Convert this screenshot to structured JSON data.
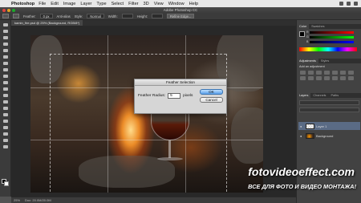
{
  "menubar": {
    "app_name": "Photoshop",
    "items": [
      "File",
      "Edit",
      "Image",
      "Layer",
      "Type",
      "Select",
      "Filter",
      "3D",
      "View",
      "Window",
      "Help"
    ]
  },
  "window": {
    "title": "Adobe Photoshop CC"
  },
  "options_bar": {
    "feather_label": "Feather:",
    "feather_value": "0 px",
    "antialias_label": "Anti-alias",
    "style_label": "Style:",
    "style_value": "Normal",
    "width_label": "Width:",
    "height_label": "Height:",
    "refine_edge": "Refine Edge..."
  },
  "document_tab": {
    "label": "kamin_fire.psd @ 25% (Background, RGB/8*)"
  },
  "status_bar": {
    "zoom": "25%",
    "doc_info": "Doc: 20.0M/20.0M"
  },
  "dialog": {
    "title": "Feather Selection",
    "field_label": "Feather Radius:",
    "field_value": "5",
    "unit": "pixels",
    "ok_label": "OK",
    "cancel_label": "Cancel"
  },
  "panels": {
    "color_tabs": [
      "Color",
      "Swatches"
    ],
    "color_channels": [
      "R",
      "G",
      "B"
    ],
    "adjustments_tabs": [
      "Adjustments",
      "Styles"
    ],
    "adjustments_hint": "Add an adjustment",
    "layers_tabs": [
      "Layers",
      "Channels",
      "Paths"
    ],
    "layers": [
      {
        "name": "Layer 1",
        "selected": true
      },
      {
        "name": "Background",
        "selected": false
      }
    ]
  },
  "watermark": {
    "title": "fotovideoeffect.com",
    "subtitle": "ВСЕ ДЛЯ ФОТО И ВИДЕО МОНТАЖА!"
  },
  "colors": {
    "ok_button": "#5aa0ea",
    "selected_layer": "#5a6b85"
  }
}
